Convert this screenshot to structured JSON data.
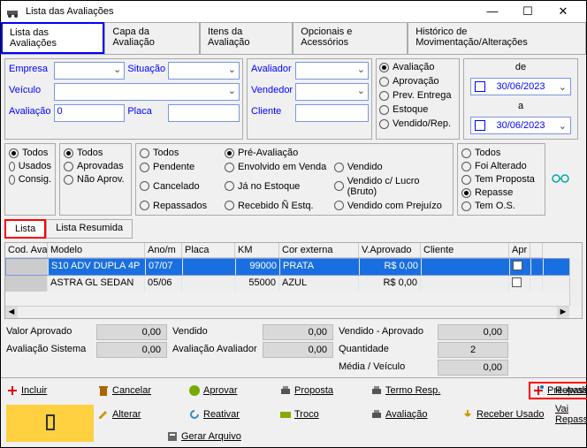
{
  "window": {
    "title": "Lista das Avaliações"
  },
  "tabs": [
    "Lista das Avaliações",
    "Capa da Avaliação",
    "Itens da Avaliação",
    "Opcionais e Acessórios",
    "Histórico de Movimentação/Alterações"
  ],
  "active_tab": 0,
  "filters": {
    "empresa": "Empresa",
    "situacao": "Situação",
    "veiculo": "Veículo",
    "avaliacao_lbl": "Avaliação",
    "avaliacao_val": "0",
    "placa": "Placa",
    "avaliador": "Avaliador",
    "vendedor": "Vendedor",
    "cliente": "Cliente"
  },
  "scope": {
    "options": [
      "Avaliação",
      "Aprovação",
      "Prev. Entrega",
      "Estoque",
      "Vendido/Rep."
    ],
    "selected": 0,
    "de": "de",
    "a": "a",
    "date_from": "30/06/2023",
    "date_to": "30/06/2023"
  },
  "rg1": {
    "options": [
      "Todos",
      "Usados",
      "Consig."
    ],
    "selected": 0
  },
  "rg2": {
    "options": [
      "Todos",
      "Aprovadas",
      "Não Aprov."
    ],
    "selected": 0
  },
  "rg3": {
    "options": [
      "Todos",
      "Pendente",
      "Cancelado",
      "Repassados",
      "Pré-Avaliação",
      "Envolvido em Venda",
      "Já no Estoque",
      "Recebido Ñ Estq.",
      "Vendido",
      "Vendido c/ Lucro (Bruto)",
      "Vendido com Prejuízo"
    ],
    "selected": 4
  },
  "rg4": {
    "options": [
      "Todos",
      "Foi Alterado",
      "Tem Proposta",
      "Repasse",
      "Tem O.S."
    ],
    "selected": 3
  },
  "list_tabs": [
    "Lista",
    "Lista Resumida"
  ],
  "list_active": 0,
  "columns": [
    "Cod. Aval",
    "Modelo",
    "Ano/m",
    "Placa",
    "KM",
    "Cor externa",
    "V.Aprovado",
    "Cliente",
    "Apr"
  ],
  "rows": [
    {
      "cod": "",
      "modelo": "S10 ADV DUPLA 4P",
      "ano": "07/07",
      "placa": "",
      "km": "99000",
      "cor": "PRATA",
      "vapr": "R$ 0,00",
      "cliente": "",
      "apr": false
    },
    {
      "cod": "",
      "modelo": "ASTRA GL SEDAN",
      "ano": "05/06",
      "placa": "",
      "km": "55000",
      "cor": "AZUL",
      "vapr": "R$ 0,00",
      "cliente": "",
      "apr": false
    }
  ],
  "totals": {
    "valor_aprovado_lbl": "Valor Aprovado",
    "valor_aprovado": "0,00",
    "vendido_lbl": "Vendido",
    "vendido": "0,00",
    "vendido_aprovado_lbl": "Vendido - Aprovado",
    "vendido_aprovado": "0,00",
    "aval_sistema_lbl": "Avaliação Sistema",
    "aval_sistema": "0,00",
    "aval_avaliador_lbl": "Avaliação Avaliador",
    "aval_avaliador": "0,00",
    "quantidade_lbl": "Quantidade",
    "quantidade": "2",
    "media_lbl": "Média / Veículo",
    "media": "0,00"
  },
  "actions": {
    "incluir": "Incluir",
    "cancelar": "Cancelar",
    "aprovar": "Aprovar",
    "proposta": "Proposta",
    "termo": "Termo Resp.",
    "repassar": "Repassar",
    "preaval": "Pré-Avaliação",
    "alterar": "Alterar",
    "reativar": "Reativar",
    "troco": "Troco",
    "avaliacao": "Avaliação",
    "receber": "Receber Usado",
    "vairepassar": "Vai Repassar",
    "gerar": "Gerar Arquivo"
  },
  "icons": {
    "plus": "#d00",
    "cancel": "#a60",
    "approve": "#7a0",
    "print": "#555",
    "check": "#c00",
    "edit": "#c90",
    "reactivate": "#38c",
    "money": "#8a0",
    "file": "#666",
    "exit": "#000",
    "glasses": "#0aa"
  }
}
